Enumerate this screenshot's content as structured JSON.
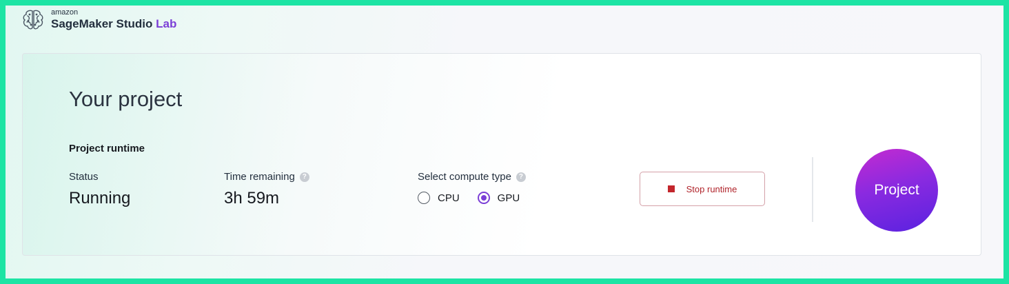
{
  "brand": {
    "small": "amazon",
    "main": "SageMaker Studio",
    "accent": "Lab",
    "icon": "brain-icon"
  },
  "project": {
    "title": "Your project",
    "section_title": "Project runtime",
    "status_label": "Status",
    "status_value": "Running",
    "time_label": "Time remaining",
    "time_value": "3h 59m",
    "compute_label": "Select compute type",
    "compute_options": [
      {
        "label": "CPU",
        "selected": false
      },
      {
        "label": "GPU",
        "selected": true
      }
    ],
    "stop_button_label": "Stop runtime",
    "project_button_label": "Project"
  },
  "colors": {
    "accent": "#7b3fd6",
    "stop": "#c3262c",
    "frame": "#1de4a4"
  }
}
